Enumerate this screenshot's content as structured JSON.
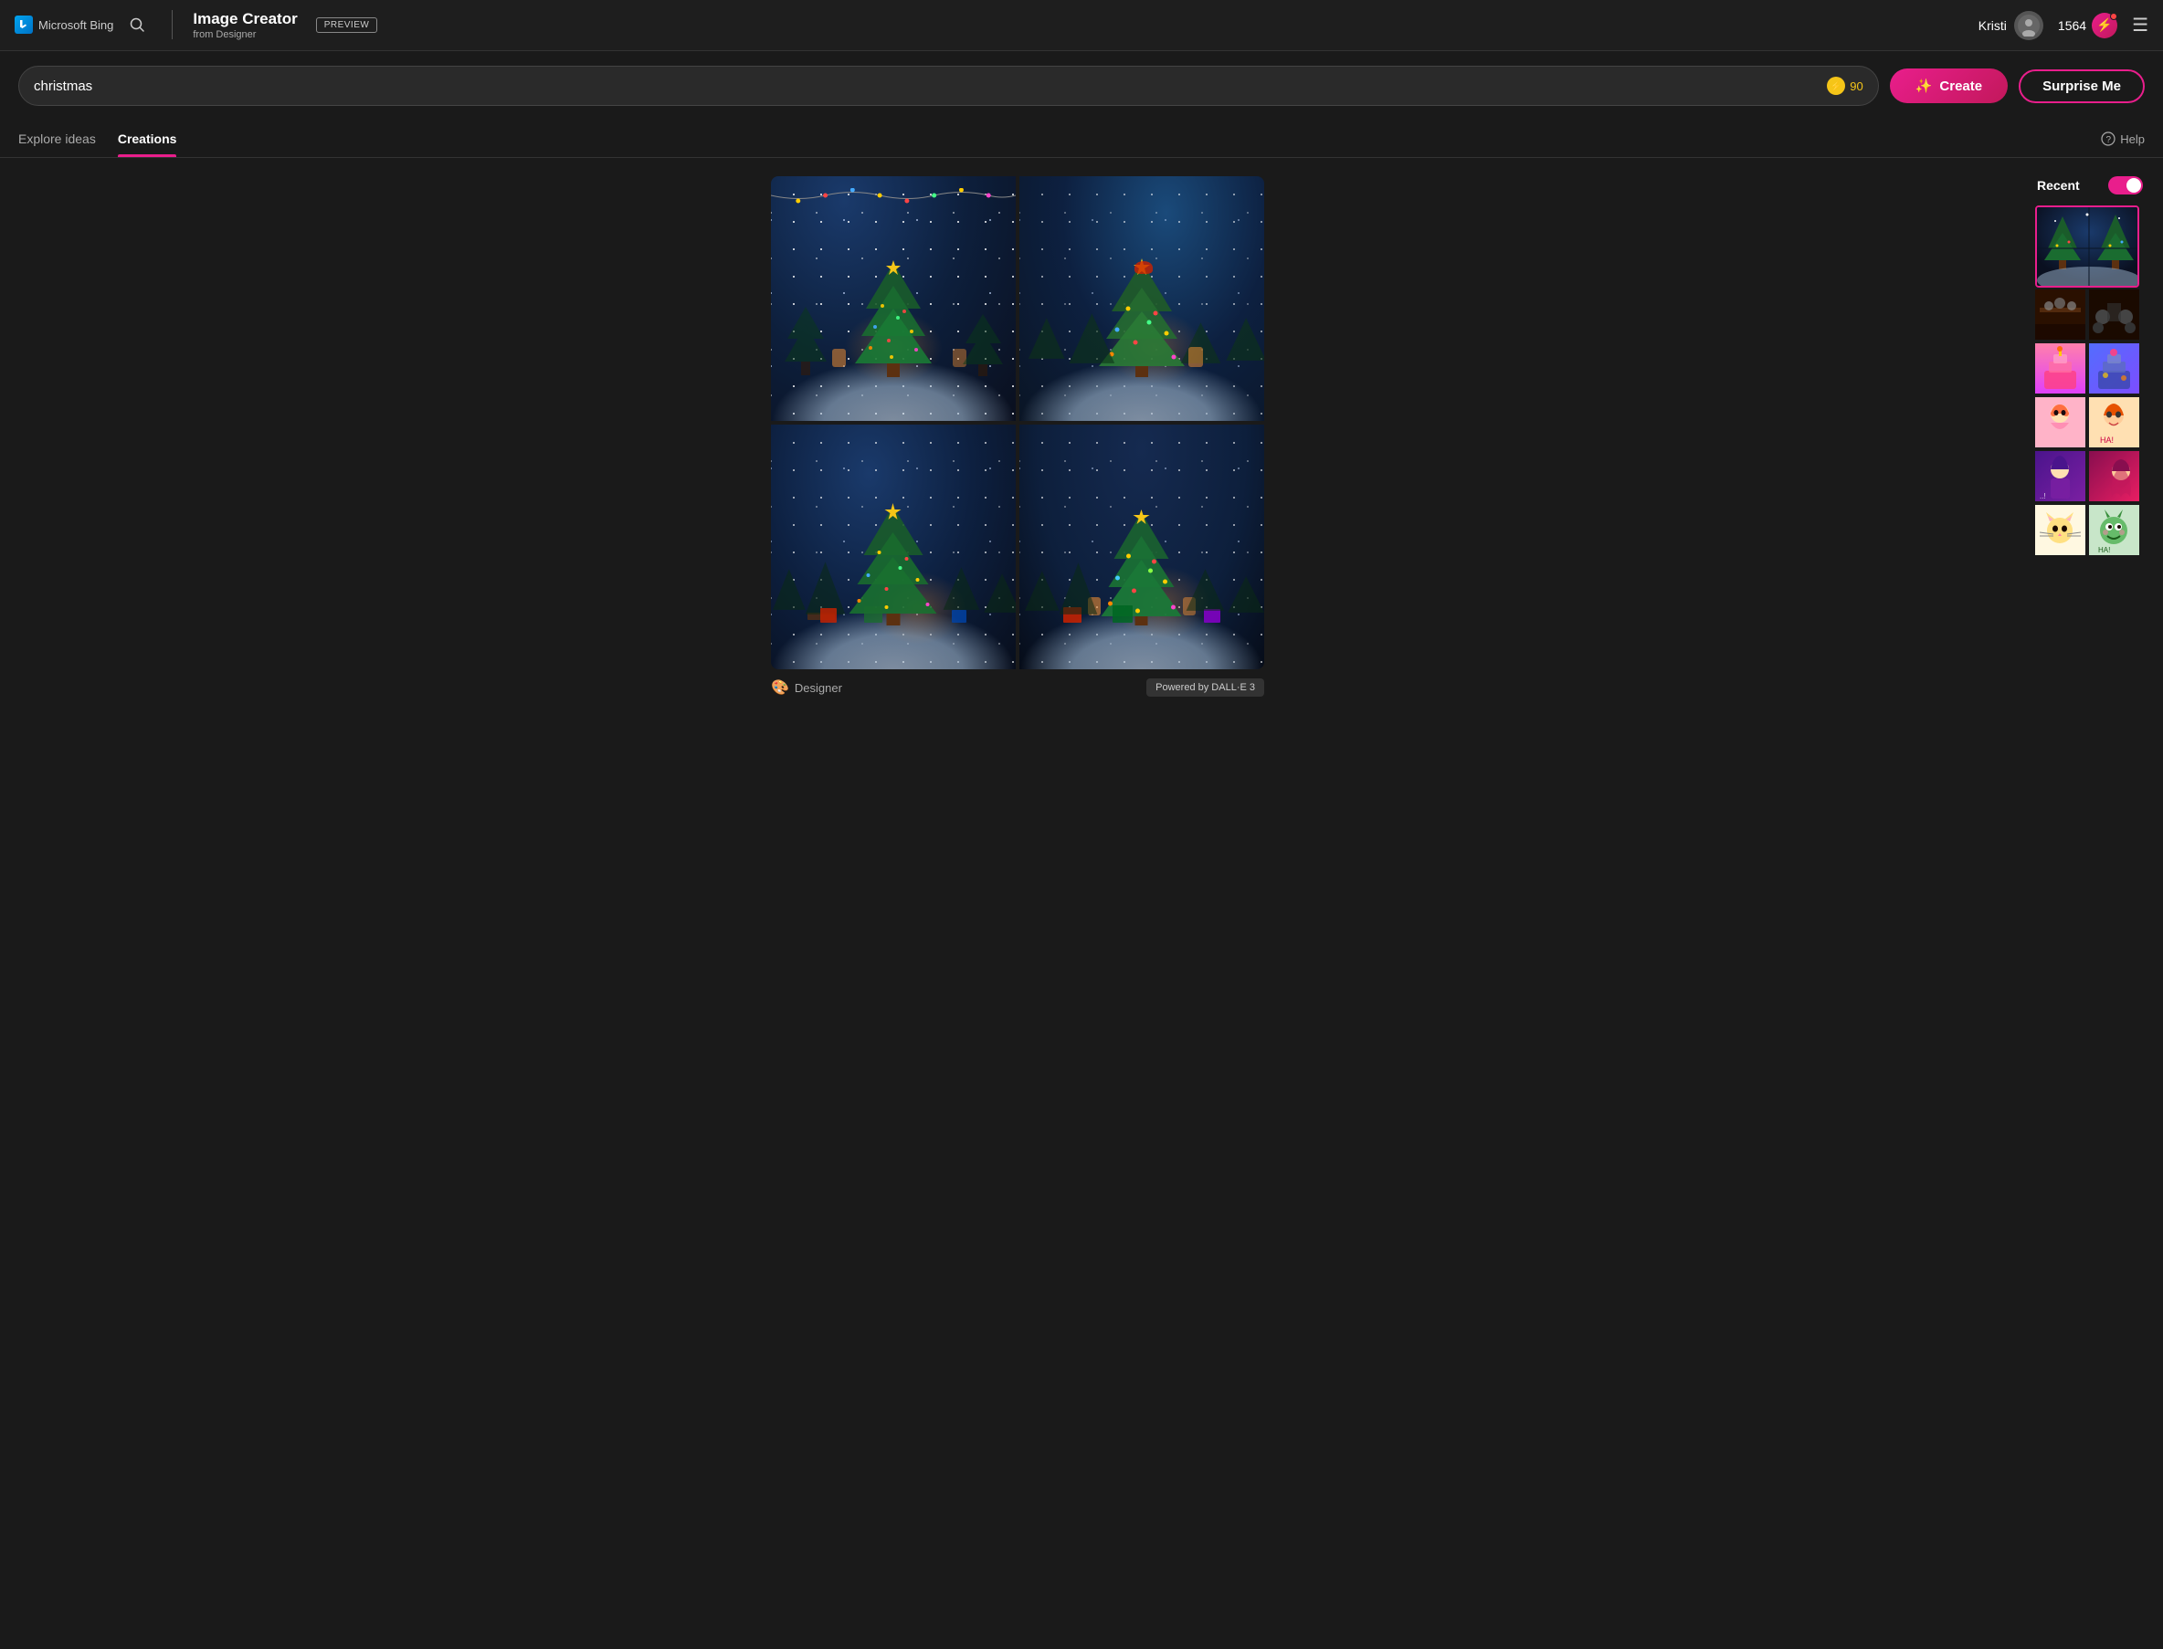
{
  "header": {
    "bing_logo": "⊞",
    "bing_text": "Microsoft Bing",
    "search_icon": "🔍",
    "app_title": "Image Creator",
    "app_subtitle": "from Designer",
    "preview_badge": "PREVIEW",
    "user_name": "Kristi",
    "credits_count": "1564",
    "menu_icon": "☰"
  },
  "search_bar": {
    "input_value": "christmas",
    "boost_count": "90",
    "create_label": "Create",
    "surprise_label": "Surprise Me"
  },
  "tabs": {
    "explore_label": "Explore ideas",
    "creations_label": "Creations",
    "help_label": "Help"
  },
  "sidebar": {
    "title": "Recent",
    "toggle_state": "on"
  },
  "footer": {
    "designer_label": "Designer",
    "dalle_label": "Powered by DALL·E 3"
  }
}
